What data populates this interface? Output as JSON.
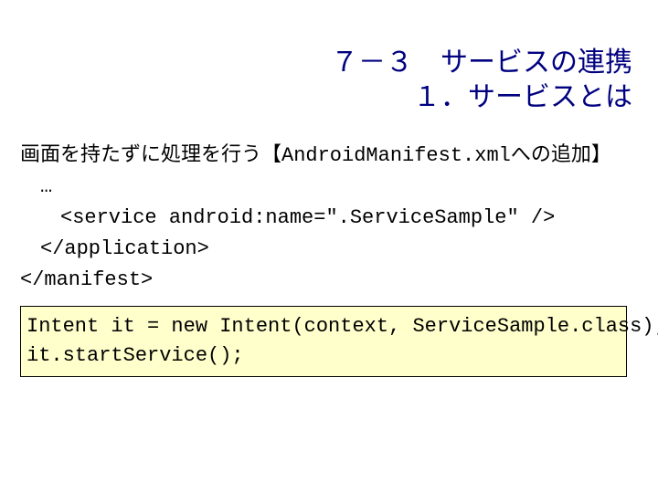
{
  "title": {
    "line1": "７－３　サービスの連携",
    "line2": "１．サービスとは"
  },
  "body": {
    "line1": "画面を持たずに処理を行う【AndroidManifest.xmlへの追加】",
    "line2": "　…",
    "line3": "　　<service android:name=\".ServiceSample\" />",
    "line4": "　</application>",
    "line5": "</manifest>"
  },
  "codebox": {
    "line1": "Intent it = new Intent(context, ServiceSample.class);",
    "line2": "it.startService();"
  }
}
